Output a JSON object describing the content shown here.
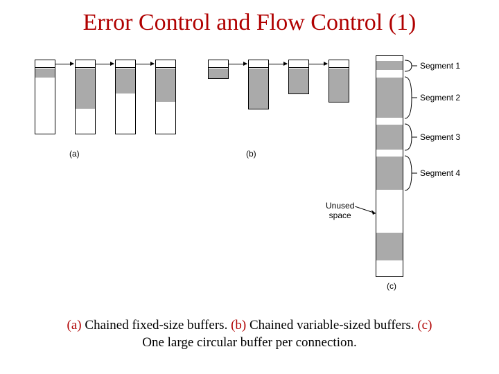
{
  "title": "Error Control and Flow Control (1)",
  "diagram": {
    "a": "(a)",
    "b": "(b)",
    "c": "(c)",
    "segments": {
      "s1": "Segment 1",
      "s2": "Segment 2",
      "s3": "Segment 3",
      "s4": "Segment 4"
    },
    "unused": "Unused\nspace"
  },
  "caption": {
    "a": "(a)",
    "a_txt": " Chained fixed-size buffers. ",
    "b": "(b)",
    "b_txt": " Chained variable-sized buffers.   ",
    "c": "(c)",
    "c_txt": "One large circular buffer per connection."
  }
}
